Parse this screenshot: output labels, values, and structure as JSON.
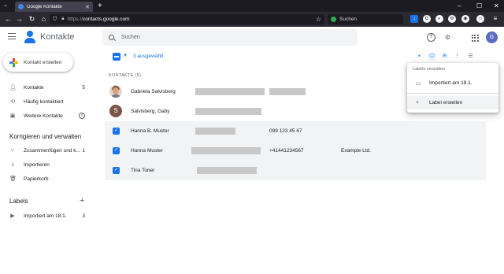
{
  "browser": {
    "tab_title": "Google Kontakte",
    "tab_close": "✕",
    "new_tab": "+",
    "url_prefix": "https://",
    "url_host": "contacts.google.com",
    "search_placeholder": "Suchen",
    "window_controls": [
      "–",
      "☐",
      "✕"
    ]
  },
  "app": {
    "title": "Kontakte",
    "search_placeholder": "Suchen",
    "avatar_letter": "G",
    "create_button_label": "Kontakt erstellen"
  },
  "sidebar": {
    "items": [
      {
        "label": "Kontakte",
        "count": "5",
        "icon": "person-icon"
      },
      {
        "label": "Häufig kontaktiert",
        "count": "",
        "icon": "history-icon"
      },
      {
        "label": "Weitere Kontakte",
        "count": "",
        "icon": "inbox-icon"
      }
    ],
    "section_fix": "Korrigieren und verwalten",
    "fix_items": [
      {
        "label": "Zusammenfügen und k...",
        "count": "1",
        "icon": "merge-icon"
      },
      {
        "label": "Importieren",
        "count": "",
        "icon": "download-icon"
      },
      {
        "label": "Papierkorb",
        "count": "",
        "icon": "trash-icon"
      }
    ],
    "section_labels": "Labels",
    "label_items": [
      {
        "label": "Importiert am 18.1.",
        "count": "3",
        "icon": "label-icon"
      }
    ]
  },
  "toolbar": {
    "selected_text": "3 ausgewählt"
  },
  "list": {
    "header": "KONTAKTE (5)",
    "rows": [
      {
        "name": "Gabriela Salvisberg",
        "selected": false,
        "avatar": "photo",
        "phone": "",
        "company": ""
      },
      {
        "name": "Salvisberg, Gaby",
        "selected": false,
        "avatar": "S",
        "phone": "",
        "company": ""
      },
      {
        "name": "Hanna B. Muster",
        "selected": true,
        "avatar": "",
        "phone": "099 123 45 67",
        "company": ""
      },
      {
        "name": "Hanna Muster",
        "selected": true,
        "avatar": "",
        "phone": "+41441234567",
        "company": "Example Ltd."
      },
      {
        "name": "Tina Toner",
        "selected": true,
        "avatar": "",
        "phone": "",
        "company": ""
      }
    ]
  },
  "label_menu": {
    "title": "Labels verwalten",
    "items": [
      {
        "label": "Importiert am 18.1.",
        "icon": "label-outline-icon"
      },
      {
        "label": "Label erstellen",
        "icon": "plus-icon"
      }
    ]
  }
}
